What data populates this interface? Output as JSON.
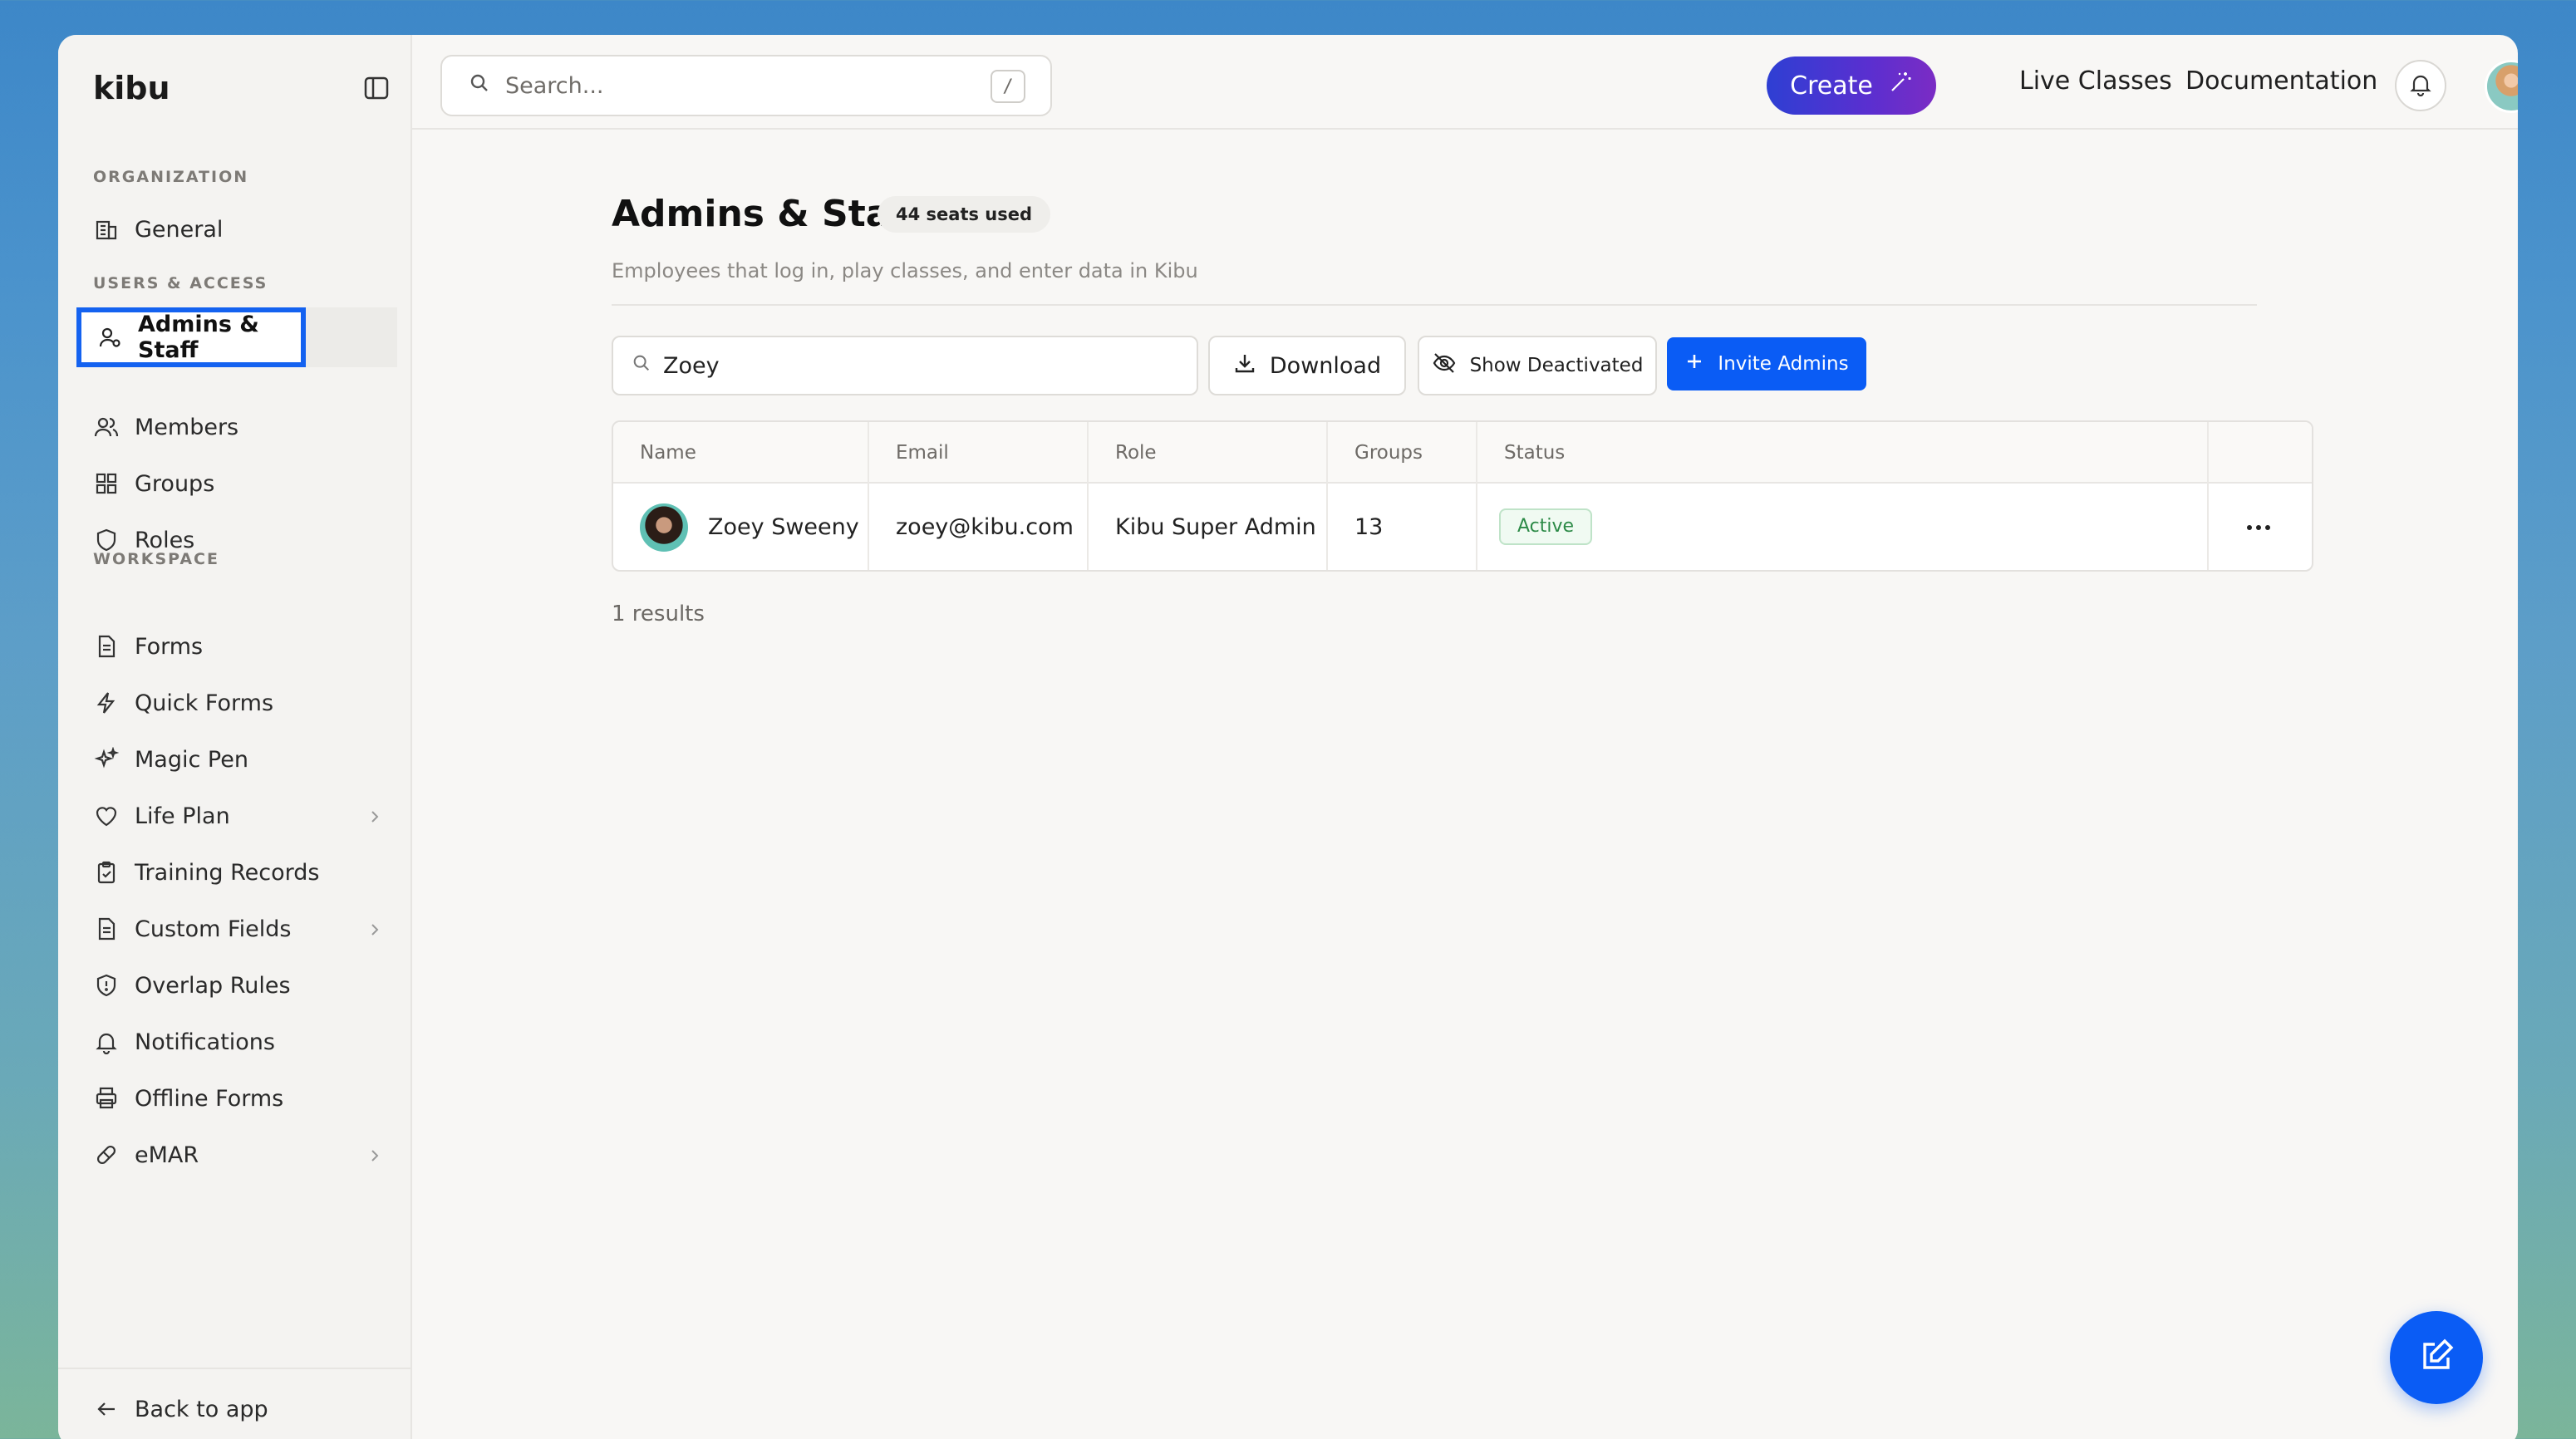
{
  "brand": "kibu",
  "search": {
    "placeholder": "Search...",
    "shortcut": "/"
  },
  "topbar": {
    "create_label": "Create",
    "live_classes": "Live Classes",
    "documentation": "Documentation"
  },
  "sidebar": {
    "sections": {
      "organization": "ORGANIZATION",
      "users_access": "USERS & ACCESS",
      "workspace": "WORKSPACE"
    },
    "items": [
      {
        "label": "General",
        "icon": "building-icon"
      },
      {
        "label": "Admins & Staff",
        "icon": "user-cog-icon",
        "active": true
      },
      {
        "label": "Members",
        "icon": "users-icon"
      },
      {
        "label": "Groups",
        "icon": "grid-icon"
      },
      {
        "label": "Roles",
        "icon": "shield-icon"
      },
      {
        "label": "Forms",
        "icon": "file-text-icon"
      },
      {
        "label": "Quick Forms",
        "icon": "lightning-icon"
      },
      {
        "label": "Magic Pen",
        "icon": "sparkles-icon"
      },
      {
        "label": "Life Plan",
        "icon": "heart-icon",
        "expandable": true
      },
      {
        "label": "Training Records",
        "icon": "clipboard-check-icon"
      },
      {
        "label": "Custom Fields",
        "icon": "file-text-icon",
        "expandable": true
      },
      {
        "label": "Overlap Rules",
        "icon": "shield-alert-icon"
      },
      {
        "label": "Notifications",
        "icon": "bell-icon"
      },
      {
        "label": "Offline Forms",
        "icon": "printer-icon"
      },
      {
        "label": "eMAR",
        "icon": "pill-icon",
        "expandable": true
      }
    ],
    "back_label": "Back to app"
  },
  "page": {
    "title": "Admins & Staff",
    "seats_badge": "44 seats used",
    "subtitle": "Employees that log in, play classes, and enter data in Kibu"
  },
  "toolbar": {
    "filter_value": "Zoey",
    "download_label": "Download",
    "show_deactivated_label": "Show Deactivated",
    "invite_label": "Invite Admins"
  },
  "table": {
    "columns": [
      "Name",
      "Email",
      "Role",
      "Groups",
      "Status"
    ],
    "rows": [
      {
        "name": "Zoey Sweeny",
        "email": "zoey@kibu.com",
        "role": "Kibu Super Admin",
        "groups": "13",
        "status": "Active"
      }
    ]
  },
  "results_text": "1 results",
  "colors": {
    "accent": "#0a5cf5",
    "active_status": "#2c8a47",
    "create_gradient_start": "#2e3fd3",
    "create_gradient_end": "#7b2cc4"
  }
}
